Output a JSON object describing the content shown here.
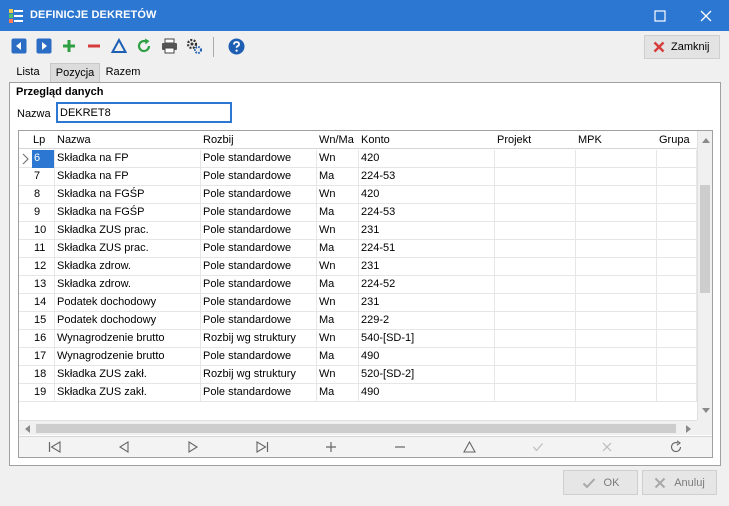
{
  "window": {
    "title": "DEFINICJE DEKRETÓW"
  },
  "toolbar": {
    "close_label": "Zamknij"
  },
  "tabs": [
    {
      "label": "Lista"
    },
    {
      "label": "Pozycja"
    },
    {
      "label": "Razem"
    }
  ],
  "section": {
    "title": "Przegląd danych"
  },
  "name_field": {
    "label": "Nazwa",
    "value": "DEKRET8"
  },
  "grid": {
    "columns": [
      "Lp",
      "Nazwa",
      "Rozbij",
      "Wn/Ma",
      "Konto",
      "Projekt",
      "MPK",
      "Grupa"
    ],
    "rows": [
      {
        "lp": "6",
        "nazwa": "Składka na FP",
        "rozbij": "Pole standardowe",
        "wnma": "Wn",
        "konto": "420"
      },
      {
        "lp": "7",
        "nazwa": "Składka na FP",
        "rozbij": "Pole standardowe",
        "wnma": "Ma",
        "konto": "224-53"
      },
      {
        "lp": "8",
        "nazwa": "Składka na FGŚP",
        "rozbij": "Pole standardowe",
        "wnma": "Wn",
        "konto": "420"
      },
      {
        "lp": "9",
        "nazwa": "Składka na FGŚP",
        "rozbij": "Pole standardowe",
        "wnma": "Ma",
        "konto": "224-53"
      },
      {
        "lp": "10",
        "nazwa": "Składka ZUS prac.",
        "rozbij": "Pole standardowe",
        "wnma": "Wn",
        "konto": "231"
      },
      {
        "lp": "11",
        "nazwa": "Składka ZUS prac.",
        "rozbij": "Pole standardowe",
        "wnma": "Ma",
        "konto": "224-51"
      },
      {
        "lp": "12",
        "nazwa": "Składka zdrow.",
        "rozbij": "Pole standardowe",
        "wnma": "Wn",
        "konto": "231"
      },
      {
        "lp": "13",
        "nazwa": "Składka zdrow.",
        "rozbij": "Pole standardowe",
        "wnma": "Ma",
        "konto": "224-52"
      },
      {
        "lp": "14",
        "nazwa": "Podatek dochodowy",
        "rozbij": "Pole standardowe",
        "wnma": "Wn",
        "konto": "231"
      },
      {
        "lp": "15",
        "nazwa": "Podatek dochodowy",
        "rozbij": "Pole standardowe",
        "wnma": "Ma",
        "konto": "229-2"
      },
      {
        "lp": "16",
        "nazwa": "Wynagrodzenie brutto",
        "rozbij": "Rozbij wg struktury",
        "wnma": "Wn",
        "konto": "540-[SD-1]"
      },
      {
        "lp": "17",
        "nazwa": "Wynagrodzenie brutto",
        "rozbij": "Pole standardowe",
        "wnma": "Ma",
        "konto": "490"
      },
      {
        "lp": "18",
        "nazwa": "Składka ZUS zakł.",
        "rozbij": "Rozbij wg struktury",
        "wnma": "Wn",
        "konto": "520-[SD-2]"
      },
      {
        "lp": "19",
        "nazwa": "Składka ZUS zakł.",
        "rozbij": "Pole standardowe",
        "wnma": "Ma",
        "konto": "490"
      }
    ]
  },
  "footer": {
    "ok_label": "OK",
    "cancel_label": "Anuluj"
  },
  "colors": {
    "titlebar": "#2b77d1",
    "selection": "#2b77d1",
    "add": "#2ea043",
    "remove": "#d83b3b"
  }
}
